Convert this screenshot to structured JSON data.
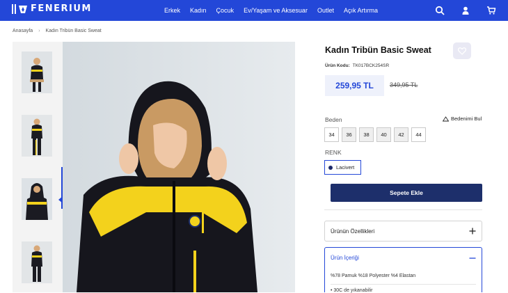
{
  "header": {
    "brand": "FENERIUM",
    "nav": [
      "Erkek",
      "Kadın",
      "Çocuk",
      "Ev/Yaşam ve Aksesuar",
      "Outlet",
      "Açık Artırma"
    ],
    "icons": [
      "search-icon",
      "user-icon",
      "cart-icon"
    ]
  },
  "breadcrumb": [
    "Anasayfa",
    "Kadın Tribün Basic Sweat"
  ],
  "gallery": {
    "thumbnails": 4,
    "active_thumbnail": 3
  },
  "product": {
    "title": "Kadın Tribün Basic Sweat",
    "code_label": "Ürün Kodu:",
    "code": "TK017BCK254SR",
    "price": "259,95 TL",
    "old_price": "349,95 TL",
    "size_label": "Beden",
    "size_guide": "Bedenimi Bul",
    "sizes": [
      "34",
      "36",
      "38",
      "40",
      "42",
      "44"
    ],
    "color_label": "RENK",
    "color": "Lacivert",
    "add_to_cart": "Sepete Ekle"
  },
  "accordion": {
    "features_label": "Ürünün Özellikleri",
    "content_label": "Ürün İçeriği",
    "content_line1": "%78 Pamuk %18 Polyester %4 Elastan",
    "content_line2": "• 30C de yıkanabilir"
  },
  "colors": {
    "header_blue": "#2347d8",
    "button_navy": "#1d2f6b",
    "jersey_yellow": "#f3d21c"
  }
}
